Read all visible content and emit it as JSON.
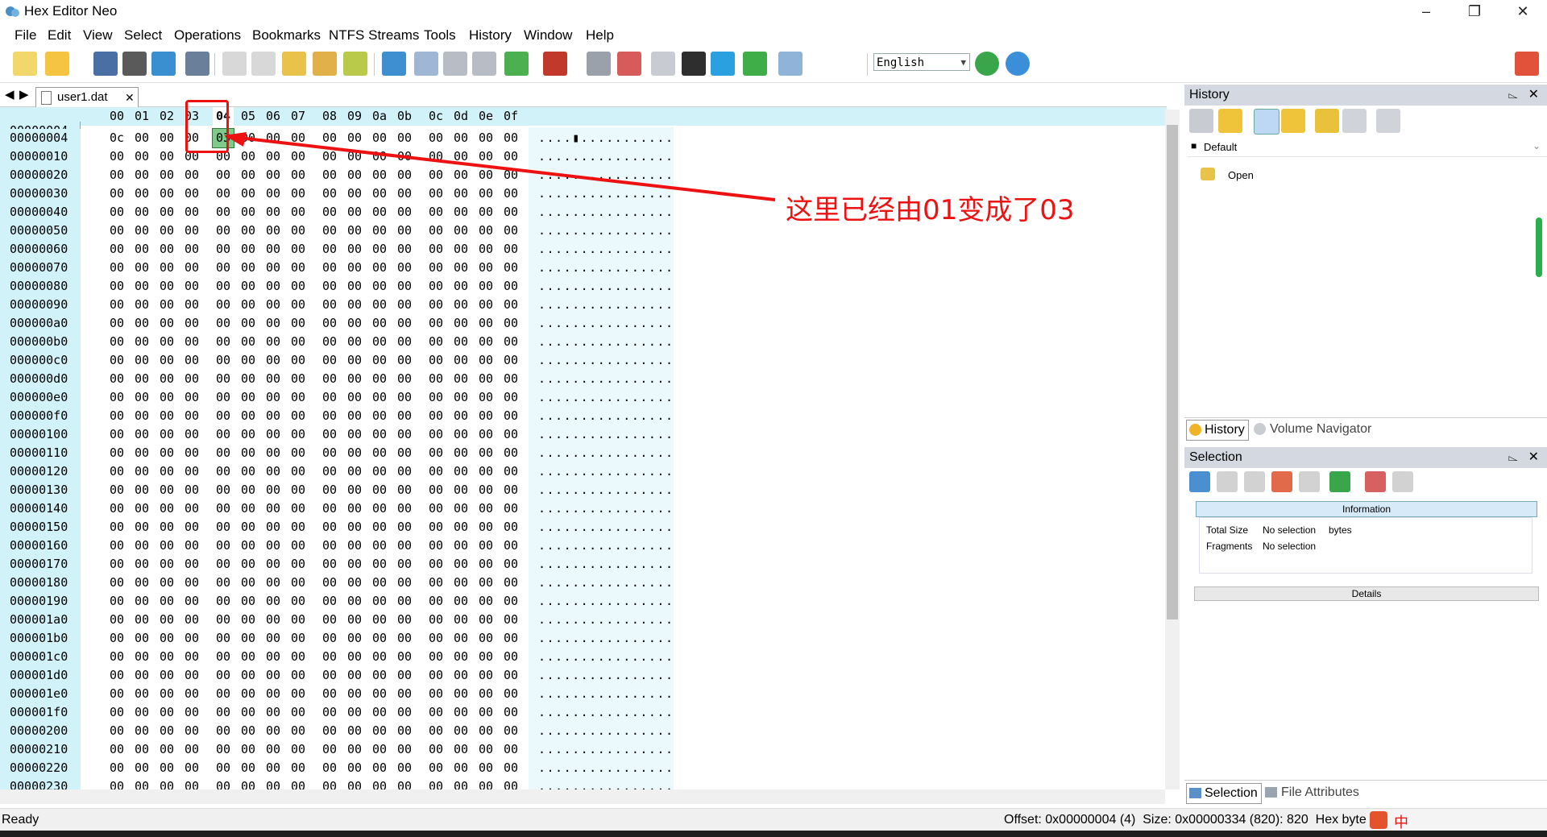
{
  "app": {
    "title": "Hex Editor Neo"
  },
  "menu": [
    {
      "label": "File"
    },
    {
      "label": "Edit"
    },
    {
      "label": "View"
    },
    {
      "label": "Select"
    },
    {
      "label": "Operations"
    },
    {
      "label": "Bookmarks"
    },
    {
      "label": "NTFS Streams"
    },
    {
      "label": "Tools"
    },
    {
      "label": "History"
    },
    {
      "label": "Window"
    },
    {
      "label": "Help"
    }
  ],
  "toolbar": {
    "language": "English"
  },
  "editor": {
    "tab_label": "user1.dat",
    "offset_label": "00000004",
    "column_headers": [
      "00",
      "01",
      "02",
      "03",
      "04",
      "05",
      "06",
      "07",
      "08",
      "09",
      "0a",
      "0b",
      "0c",
      "0d",
      "0e",
      "0f"
    ],
    "selected_column": "04",
    "first_row": {
      "address": "00000004",
      "bytes": [
        "0c",
        "00",
        "00",
        "00",
        "03",
        "00",
        "00",
        "00",
        "00",
        "00",
        "00",
        "00",
        "00",
        "00",
        "00",
        "00"
      ],
      "ascii": "....▮..........."
    },
    "row_addresses": [
      "00000010",
      "00000020",
      "00000030",
      "00000040",
      "00000050",
      "00000060",
      "00000070",
      "00000080",
      "00000090",
      "000000a0",
      "000000b0",
      "000000c0",
      "000000d0",
      "000000e0",
      "000000f0",
      "00000100",
      "00000110",
      "00000120",
      "00000130",
      "00000140",
      "00000150",
      "00000160",
      "00000170",
      "00000180",
      "00000190",
      "000001a0",
      "000001b0",
      "000001c0",
      "000001d0",
      "000001e0",
      "000001f0",
      "00000200",
      "00000210",
      "00000220",
      "00000230"
    ],
    "zero_byte": "00",
    "zero_ascii": "................"
  },
  "annotation": {
    "text": "这里已经由01变成了03"
  },
  "history_panel": {
    "title": "History",
    "group_label": "Default",
    "entries": [
      {
        "label": "Open"
      }
    ],
    "tabs": [
      {
        "label": "History"
      },
      {
        "label": "Volume Navigator"
      }
    ]
  },
  "selection_panel": {
    "title": "Selection",
    "info_header": "Information",
    "rows": [
      {
        "label": "Total Size",
        "value": "No selection",
        "unit": "bytes"
      },
      {
        "label": "Fragments",
        "value": "No selection",
        "unit": ""
      }
    ],
    "details_label": "Details",
    "tabs": [
      {
        "label": "Selection"
      },
      {
        "label": "File Attributes"
      }
    ]
  },
  "status": {
    "left": "Ready",
    "right": "Offset: 0x00000004 (4)  Size: 0x00000334 (820): 820  Hex byte"
  },
  "colors": {
    "accent": "#d2f2fa",
    "annotation": "#e11111",
    "selected_byte": "#7fc98a"
  }
}
